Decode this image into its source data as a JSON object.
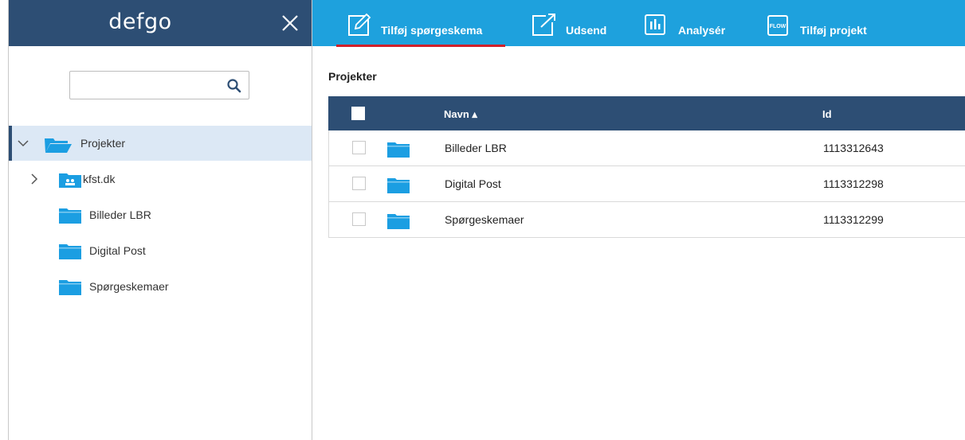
{
  "sidebar": {
    "brand": "defgo",
    "search": {
      "value": "",
      "placeholder": ""
    },
    "tree": [
      {
        "label": "Projekter",
        "expanded": true,
        "selected": true
      },
      {
        "label": "kfst.dk",
        "expanded": false,
        "shared": true
      },
      {
        "label": "Billeder LBR"
      },
      {
        "label": "Digital Post"
      },
      {
        "label": "Spørgeskemaer"
      }
    ]
  },
  "toolbar": {
    "add_survey": "Tilføj spørgeskema",
    "send": "Udsend",
    "analyze": "Analysér",
    "flow_badge": "FLOW",
    "add_project": "Tilføj projekt"
  },
  "main": {
    "section_title": "Projekter",
    "columns": {
      "name": "Navn ▴",
      "id": "Id"
    },
    "rows": [
      {
        "name": "Billeder LBR",
        "id": "1113312643"
      },
      {
        "name": "Digital Post",
        "id": "1113312298"
      },
      {
        "name": "Spørgeskemaer",
        "id": "1113312299"
      }
    ]
  },
  "colors": {
    "navy": "#2d4e74",
    "topbar_blue": "#1ea1dd",
    "folder_blue": "#1b9ee2",
    "active_underline": "#d0202a",
    "selected_bg": "#dce8f5"
  }
}
